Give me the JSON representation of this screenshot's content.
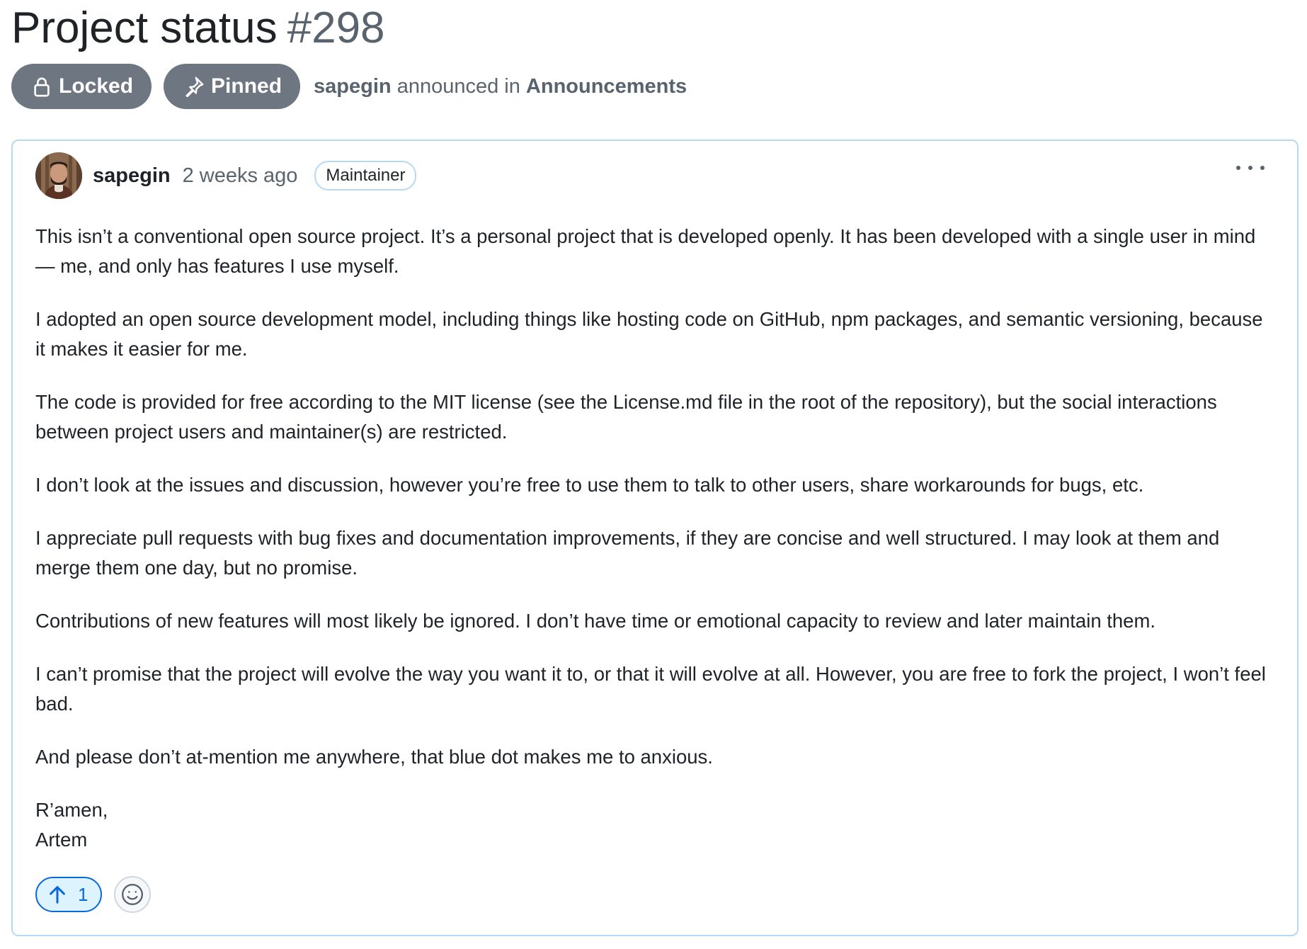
{
  "discussion": {
    "title": "Project status",
    "number": "#298"
  },
  "meta": {
    "locked_label": "Locked",
    "pinned_label": "Pinned",
    "author": "sapegin",
    "action_text": "announced in",
    "category": "Announcements"
  },
  "post": {
    "author": "sapegin",
    "timestamp": "2 weeks ago",
    "role_badge": "Maintainer",
    "more_icon": "kebab-horizontal-icon",
    "paragraphs": [
      "This isn’t a conventional open source project. It’s a personal project that is developed openly. It has been developed with a single user in mind — me, and only has features I use myself.",
      "I adopted an open source development model, including things like hosting code on GitHub, npm packages, and semantic versioning, because it makes it easier for me.",
      "The code is provided for free according to the MIT license (see the License.md file in the root of the repository), but the social interactions between project users and maintainer(s) are restricted.",
      "I don’t look at the issues and discussion, however you’re free to use them to talk to other users, share workarounds for bugs, etc.",
      "I appreciate pull requests with bug fixes and documentation improvements, if they are concise and well structured. I may look at them and merge them one day, but no promise.",
      "Contributions of new features will most likely be ignored. I don’t have time or emotional capacity to review and later maintain them.",
      "I can’t promise that the project will evolve the way you want it to, or that it will evolve at all. However, you are free to fork the project, I won’t feel bad.",
      "And please don’t at-mention me anywhere, that blue dot makes me to anxious."
    ],
    "signoff_line1": "R’amen,",
    "signoff_line2": "Artem"
  },
  "reactions": {
    "upvote_icon": "arrow-up-icon",
    "upvote_count": "1",
    "add_reaction_icon": "smiley-icon"
  },
  "colors": {
    "pill_bg": "#6e7781",
    "card_border": "#b6daf2",
    "accent": "#0969da",
    "accent_bg": "#ddf4ff",
    "muted_text": "#59636e"
  }
}
